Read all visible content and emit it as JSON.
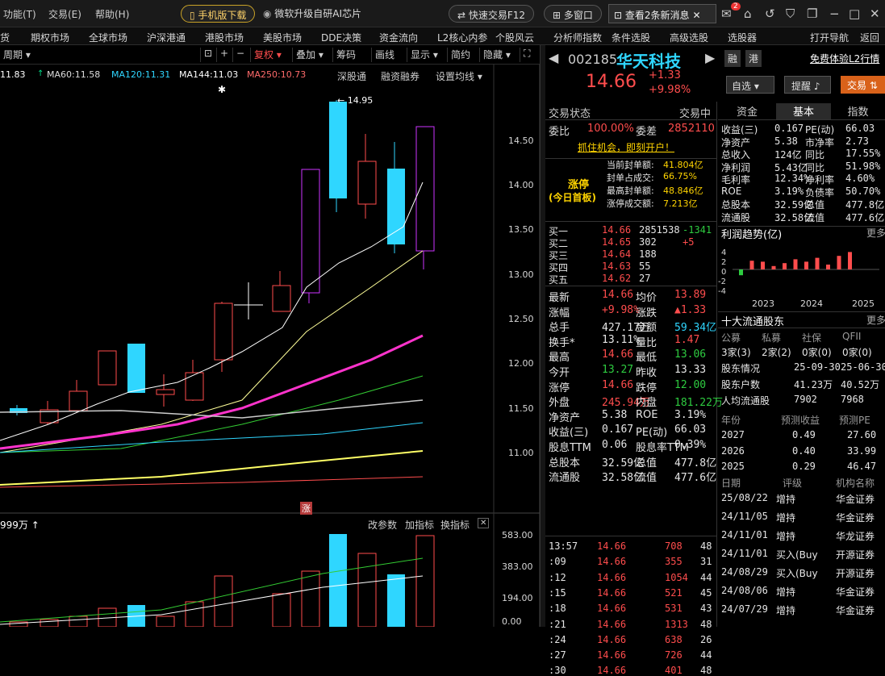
{
  "menu": [
    "功能(T)",
    "交易(E)",
    "帮助(H)"
  ],
  "top_buttons": {
    "mobile": "手机版下载",
    "ms": "微软升级自研AI芯片",
    "fast_trade": "快速交易F12",
    "multi_window": "多窗口",
    "news": "查看2条新消息",
    "mail_badge": "2"
  },
  "nav": [
    "货",
    "期权市场",
    "全球市场",
    "沪深港通",
    "港股市场",
    "美股市场",
    "DDE决策",
    "资金流向",
    "L2核心内参",
    "个股风云",
    "分析师指数",
    "条件选股",
    "高级选股",
    "选股器"
  ],
  "nav_right": [
    "打开导航",
    "返回"
  ],
  "chart_toolbar": {
    "period": "周期",
    "adjust": "复权",
    "overlay": "叠加",
    "chips": "筹码",
    "draw": "画线",
    "display": "显示",
    "brief": "简约",
    "hide": "隐藏"
  },
  "ma_labels": {
    "ma30": "11.83",
    "ma60": "MA60:11.58",
    "ma120": "MA120:11.31",
    "ma144": "MA144:11.03",
    "ma250": "MA250:10.73"
  },
  "chart_links": {
    "sgt": "深股通",
    "margin": "融资融券",
    "ma_setting": "设置均线"
  },
  "price_axis": [
    "14.50",
    "14.00",
    "13.50",
    "13.00",
    "12.50",
    "12.00",
    "11.50",
    "11.00"
  ],
  "high_label": "14.95",
  "limit_tag": "涨",
  "vol_label": "999万",
  "vol_links": {
    "params": "改参数",
    "add": "加指标",
    "switch": "换指标"
  },
  "vol_axis": [
    "583.00",
    "383.00",
    "194.00",
    "0.00"
  ],
  "stock": {
    "code": "002185",
    "name": "华天科技",
    "price": "14.66",
    "change": "+1.33",
    "pct": "+9.98%",
    "tag1": "融",
    "tag2": "港",
    "promo": "免费体验L2行情",
    "watch": "自选",
    "alert": "提醒",
    "trade": "交易"
  },
  "status": {
    "label": "交易状态",
    "value": "交易中",
    "wb_label": "委比",
    "wb": "100.00%",
    "wc_label": "委差",
    "wc": "2852110",
    "chance": "抓住机会，即刻开户！"
  },
  "limit": {
    "title": "涨停",
    "sub": "(今日首板)",
    "rows": [
      [
        "当前封单额:",
        "41.804亿"
      ],
      [
        "封单占成交:",
        "66.75%"
      ],
      [
        "最高封单额:",
        "48.846亿"
      ],
      [
        "涨停成交额:",
        "7.213亿"
      ]
    ]
  },
  "bids": [
    [
      "买一",
      "14.66",
      "2851538",
      "-1341"
    ],
    [
      "买二",
      "14.65",
      "302",
      "+5"
    ],
    [
      "买三",
      "14.64",
      "188",
      ""
    ],
    [
      "买四",
      "14.63",
      "55",
      ""
    ],
    [
      "买五",
      "14.62",
      "27",
      ""
    ]
  ],
  "quote": [
    [
      "最新",
      "14.66",
      "均价",
      "13.89"
    ],
    [
      "涨幅",
      "+9.98%",
      "涨跌",
      "▲1.33"
    ],
    [
      "总手",
      "427.17万",
      "金额",
      "59.34亿"
    ],
    [
      "换手*",
      "13.11%",
      "量比",
      "1.47"
    ],
    [
      "最高",
      "14.66",
      "最低",
      "13.06"
    ],
    [
      "今开",
      "13.27",
      "昨收",
      "13.33"
    ],
    [
      "涨停",
      "14.66",
      "跌停",
      "12.00"
    ],
    [
      "外盘",
      "245.94万",
      "内盘",
      "181.22万"
    ],
    [
      "净资产",
      "5.38",
      "ROE",
      "3.19%"
    ],
    [
      "收益(三)",
      "0.167",
      "PE(动)",
      "66.03"
    ],
    [
      "股息TTM",
      "0.06",
      "股息率TTM",
      "0.39%"
    ],
    [
      "总股本",
      "32.59亿",
      "总值",
      "477.8亿"
    ],
    [
      "流通股",
      "32.58亿",
      "流值",
      "477.6亿"
    ]
  ],
  "ticks": [
    [
      "13:57",
      "14.66",
      "708",
      "48"
    ],
    [
      ":09",
      "14.66",
      "355",
      "31"
    ],
    [
      ":12",
      "14.66",
      "1054",
      "44"
    ],
    [
      ":15",
      "14.66",
      "521",
      "45"
    ],
    [
      ":18",
      "14.66",
      "531",
      "43"
    ],
    [
      ":21",
      "14.66",
      "1313",
      "48"
    ],
    [
      ":24",
      "14.66",
      "638",
      "26"
    ],
    [
      ":27",
      "14.66",
      "726",
      "44"
    ],
    [
      ":30",
      "14.66",
      "401",
      "48"
    ]
  ],
  "f10_tabs": [
    "资金",
    "基本",
    "指数"
  ],
  "fund": [
    [
      "收益(三)",
      "0.167",
      "PE(动)",
      "66.03"
    ],
    [
      "净资产",
      "5.38",
      "市净率",
      "2.73"
    ],
    [
      "总收入",
      "124亿",
      "同比",
      "17.55%"
    ],
    [
      "净利润",
      "5.43亿",
      "同比",
      "51.98%"
    ],
    [
      "毛利率",
      "12.34%",
      "净利率",
      "4.60%"
    ],
    [
      "ROE",
      "3.19%",
      "负债率",
      "50.70%"
    ],
    [
      "总股本",
      "32.59亿",
      "总值",
      "477.8亿"
    ],
    [
      "流通股",
      "32.58亿",
      "流值",
      "477.6亿"
    ]
  ],
  "profit_trend": {
    "title": "利润趋势(亿)",
    "more": "更多",
    "years": [
      "2023",
      "2024",
      "2025"
    ],
    "ticks": [
      "4",
      "2",
      "0",
      "-2",
      "-4"
    ],
    "values": [
      -1.2,
      1.8,
      1.6,
      0.7,
      1.3,
      2.1,
      1.6,
      2.4,
      1.0,
      2.8,
      3.6
    ]
  },
  "holders": {
    "title": "十大流通股东",
    "more": "更多",
    "cols": [
      "公募",
      "私募",
      "社保",
      "QFII"
    ],
    "vals": [
      "3家(3)",
      "2家(2)",
      "0家(0)",
      "0家(0)"
    ],
    "rows": [
      [
        "股东情况",
        "25-09-30",
        "25-06-30"
      ],
      [
        "股东户数",
        "41.23万",
        "40.52万"
      ],
      [
        "人均流通股",
        "7902",
        "7968"
      ]
    ]
  },
  "forecast": {
    "head": [
      "年份",
      "预测收益",
      "预测PE"
    ],
    "rows": [
      [
        "2027",
        "0.49",
        "27.60"
      ],
      [
        "2026",
        "0.40",
        "33.99"
      ],
      [
        "2025",
        "0.29",
        "46.47"
      ]
    ]
  },
  "ratings": {
    "head": [
      "日期",
      "评级",
      "机构名称"
    ],
    "rows": [
      [
        "25/08/22",
        "增持",
        "华金证券"
      ],
      [
        "24/11/05",
        "增持",
        "华金证券"
      ],
      [
        "24/11/01",
        "增持",
        "华龙证券"
      ],
      [
        "24/11/01",
        "买入(Buy",
        "开源证券"
      ],
      [
        "24/08/29",
        "买入(Buy",
        "开源证券"
      ],
      [
        "24/08/06",
        "增持",
        "华金证券"
      ],
      [
        "24/07/29",
        "增持",
        "华金证券"
      ]
    ]
  }
}
